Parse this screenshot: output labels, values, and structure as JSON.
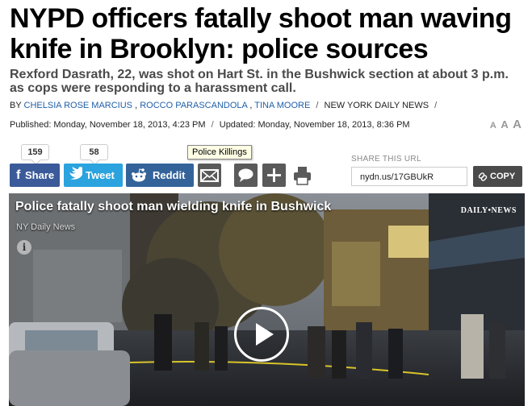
{
  "article": {
    "headline": "NYPD officers fatally shoot man waving knife in Brooklyn: police sources",
    "subhead": "Rexford Dasrath, 22, was shot on Hart St. in the Bushwick section at about 3 p.m. as cops were responding to a harassment call.",
    "byline": {
      "prefix": "BY",
      "authors": [
        "CHELSIA ROSE MARCIUS",
        "ROCCO PARASCANDOLA",
        "TINA MOORE"
      ],
      "separator": "/",
      "publication": "NEW YORK DAILY NEWS"
    },
    "dates": {
      "published": "Published: Monday, November 18, 2013, 4:23 PM",
      "separator": "/",
      "updated": "Updated: Monday, November 18, 2013, 8:36 PM"
    },
    "text_size": [
      "A",
      "A",
      "A"
    ]
  },
  "share": {
    "facebook": {
      "count": "159",
      "label": "Share",
      "color": "#3b5a99"
    },
    "twitter": {
      "count": "58",
      "label": "Tweet",
      "color": "#2aa3de"
    },
    "reddit": {
      "label": "Reddit",
      "color": "#34639a"
    },
    "tooltip": "Police Killings",
    "url_label": "SHARE THIS URL",
    "url": "nydn.us/17GBUkR",
    "copy_label": "COPY",
    "icons": [
      "mail-icon",
      "comment-icon",
      "plus-icon",
      "print-icon"
    ]
  },
  "video": {
    "title": "Police fatally shoot man wielding knife in Bushwick",
    "source": "NY Daily News",
    "info": "i",
    "logo": "DAILY•NEWS"
  }
}
